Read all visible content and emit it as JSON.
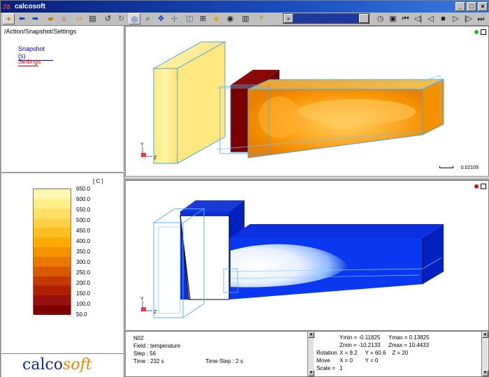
{
  "window": {
    "title": "calcosoft",
    "logo_glyph": "7δ"
  },
  "toolbar": {
    "playback": [
      "◷",
      "▣",
      "⏮",
      "◁|",
      "◁",
      "■",
      "▷",
      "|▷",
      "⏭"
    ],
    "slider_label": "»"
  },
  "left": {
    "path": "/Action/Snapshot/Settings",
    "links": [
      "Snapshot (s)",
      "Settings"
    ]
  },
  "legend": {
    "unit": "[ C ]",
    "levels": [
      "650.0",
      "600.0",
      "550.0",
      "500.0",
      "450.0",
      "400.0",
      "350.0",
      "300.0",
      "250.0",
      "200.0",
      "150.0",
      "100.0",
      "50.0"
    ],
    "colors": [
      "#fff7b0",
      "#ffee88",
      "#ffe066",
      "#ffd044",
      "#ffbe22",
      "#ffaa00",
      "#f59200",
      "#e87800",
      "#d85a00",
      "#c53a00",
      "#b02000",
      "#981010",
      "#7c0000"
    ]
  },
  "logo": {
    "calco": "calco",
    "soft": "soft"
  },
  "views": {
    "scale_label": "0.02109"
  },
  "status": {
    "name": "N02",
    "field": "Field :  temperature",
    "step": "Step :  56",
    "time": "Time :  232 s",
    "timestep": "Time-Step :  2 s",
    "ymin": "Ymin = -0.11825",
    "ymax": "Ymax = 0.13825",
    "zmin": "Zmin = -10.2133",
    "zmax": "Zmax = 10.4433",
    "rotation_label": "Rotation",
    "rotation": "X = 9.2     Y = 60.6    Z = 20",
    "move_label": "Move",
    "move": "X = 0        Y = 0",
    "scale_label": "Scale =",
    "scale": "1"
  }
}
